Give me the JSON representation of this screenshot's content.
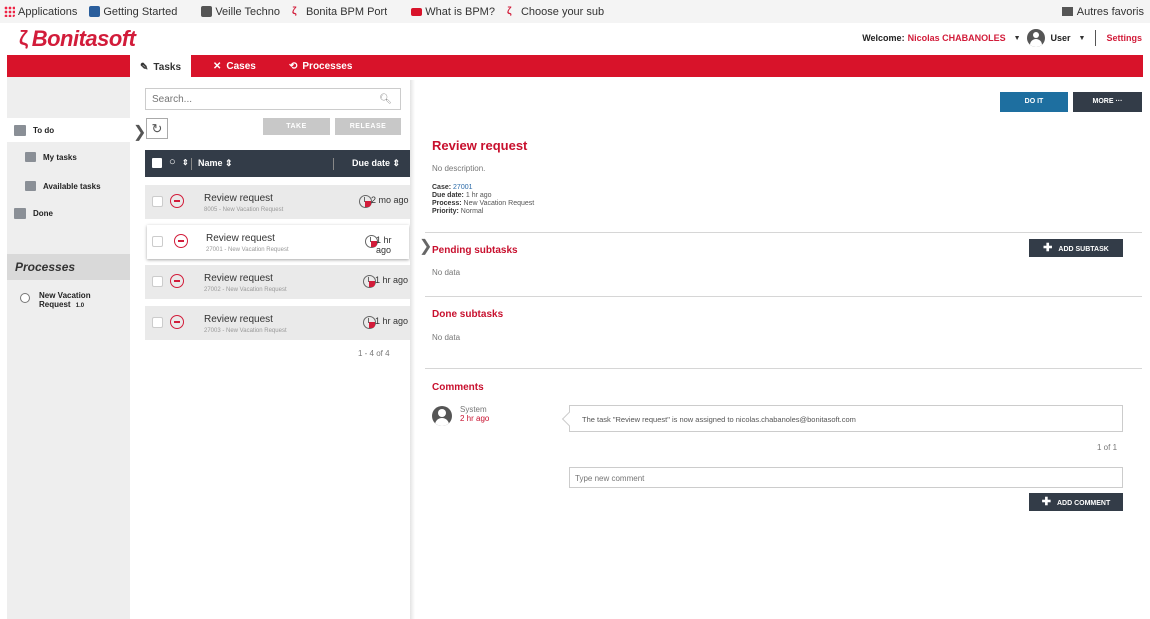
{
  "bookmarks": {
    "items": [
      {
        "label": "Applications",
        "icon": "apps-grid-icon"
      },
      {
        "label": "Getting Started",
        "icon": "firefox-page-icon"
      },
      {
        "label": "Veille Techno",
        "icon": "folder-icon"
      },
      {
        "label": "Bonita BPM Port",
        "icon": "bonita-icon"
      },
      {
        "label": "What is BPM?",
        "icon": "flag-icon"
      },
      {
        "label": "Choose your sub",
        "icon": "bonita-icon"
      }
    ],
    "right": "Autres favoris"
  },
  "header": {
    "logo": "Bonitasoft",
    "welcome": "Welcome:",
    "username": "Nicolas CHABANOLES",
    "profile": "User",
    "settings": "Settings"
  },
  "nav": {
    "tabs": [
      {
        "label": "Tasks",
        "icon": "✎"
      },
      {
        "label": "Cases",
        "icon": "✕"
      },
      {
        "label": "Processes",
        "icon": "⟲"
      }
    ]
  },
  "sidebar": {
    "todo": "To do",
    "my_tasks": "My tasks",
    "available_tasks": "Available tasks",
    "done": "Done",
    "processes_title": "Processes",
    "process_name": "New Vacation Request",
    "process_version": "1.0"
  },
  "tasklist": {
    "search_placeholder": "Search...",
    "take": "TAKE",
    "release": "RELEASE",
    "col_name": "Name ⇕",
    "col_due": "Due date ⇕",
    "rows": [
      {
        "name": "Review request",
        "sub": "8005 - New Vacation Request",
        "due": "2 mo ago"
      },
      {
        "name": "Review request",
        "sub": "27001 - New Vacation Request",
        "due": "1 hr ago"
      },
      {
        "name": "Review request",
        "sub": "27002 - New Vacation Request",
        "due": "1 hr ago"
      },
      {
        "name": "Review request",
        "sub": "27003 - New Vacation Request",
        "due": "1 hr ago"
      }
    ],
    "pager": "1 - 4 of 4"
  },
  "detail": {
    "do_it": "DO IT",
    "more": "MORE ···",
    "title": "Review request",
    "description": "No description.",
    "case_label": "Case:",
    "case_value": "27001",
    "due_label": "Due date:",
    "due_value": "1 hr ago",
    "process_label": "Process:",
    "process_value": "New Vacation Request",
    "priority_label": "Priority:",
    "priority_value": "Normal",
    "pending_title": "Pending subtasks",
    "add_subtask": "ADD SUBTASK",
    "pending_empty": "No data",
    "done_title": "Done subtasks",
    "done_empty": "No data",
    "comments_title": "Comments",
    "comment_author": "System",
    "comment_time": "2 hr ago",
    "comment_text": "The task \"Review request\" is now assigned to nicolas.chabanoles@bonitasoft.com",
    "comment_pager": "1 of 1",
    "comment_placeholder": "Type new comment",
    "add_comment": "ADD COMMENT"
  },
  "colors": {
    "brand_red": "#d8132a",
    "dark_header": "#333c48",
    "primary_blue": "#1e6fa0"
  }
}
